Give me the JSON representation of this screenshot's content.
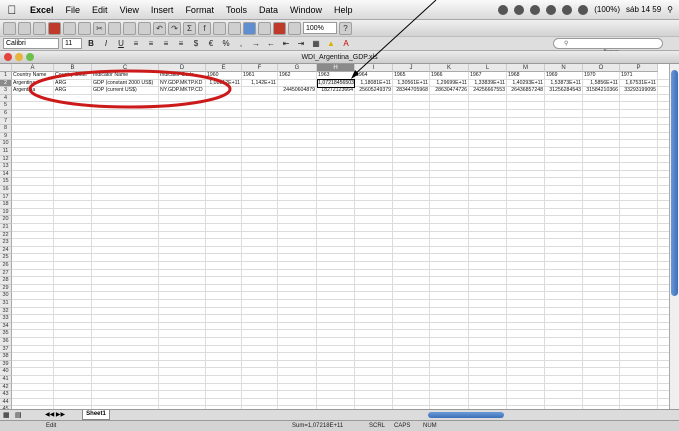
{
  "menubar": {
    "apple": "",
    "app": "Excel",
    "items": [
      "File",
      "Edit",
      "View",
      "Insert",
      "Format",
      "Tools",
      "Data",
      "Window",
      "Help"
    ],
    "battery": "(100%)",
    "clock": "sáb 14 59"
  },
  "toolbar": {
    "zoom": "100%"
  },
  "formatbar": {
    "font": "Calibri",
    "size": "11"
  },
  "search": {
    "placeholder": "Buscar"
  },
  "window_title": "WDI_Argentina_GDP.xls",
  "columns": [
    "A",
    "B",
    "C",
    "D",
    "E",
    "F",
    "G",
    "H",
    "I",
    "J",
    "K",
    "L",
    "M",
    "N",
    "O",
    "P"
  ],
  "rows_count": 45,
  "cells": {
    "A1": "Country Name",
    "B1": "Country Code",
    "C1": "Indicator Name",
    "D1": "Indicator Code",
    "E1": "1960",
    "F1": "1961",
    "G1": "1962",
    "H1": "1963",
    "I1": "1964",
    "J1": "1965",
    "K1": "1966",
    "L1": "1967",
    "M1": "1968",
    "N1": "1969",
    "O1": "1970",
    "P1": "1971",
    "A2": "Argentina",
    "B2": "ARG",
    "C2": "GDP (constant 2000 US$)",
    "D2": "NY.GDP.MKTP.KD",
    "E2": "1,08312E+11",
    "F2": "1,142E+11",
    "G2": "",
    "H2": "1,07218456503,731",
    "I2": "1,18081E+11",
    "J2": "1,30561E+11",
    "K2": "1,29699E+11",
    "L2": "1,33839E+11",
    "M2": "1,40293E+11",
    "N2": "1,53873E+11",
    "O2": "1,5856E+11",
    "P2": "1,67531E+11",
    "A3": "Argentina",
    "B3": "ARG",
    "C3": "GDP (current US$)",
    "D3": "NY.GDP.MKTP.CD",
    "E3": "",
    "F3": "",
    "G3": "24450604879",
    "H3": "18272123664",
    "I3": "25605249379",
    "J3": "28344705968",
    "K3": "28630474726",
    "L3": "24256667553",
    "M3": "26436857248",
    "N3": "31256284543",
    "O3": "31584210366",
    "P3": "33293199095"
  },
  "sheet_tab": "Sheet1",
  "statusbar": {
    "mode": "Edit",
    "sum": "Sum=1,07218E+11",
    "scrl": "SCRL",
    "caps": "CAPS",
    "num": "NUM"
  },
  "colors": {
    "annotation": "#cc1a1a",
    "scroll_thumb": "#4f82c6"
  }
}
